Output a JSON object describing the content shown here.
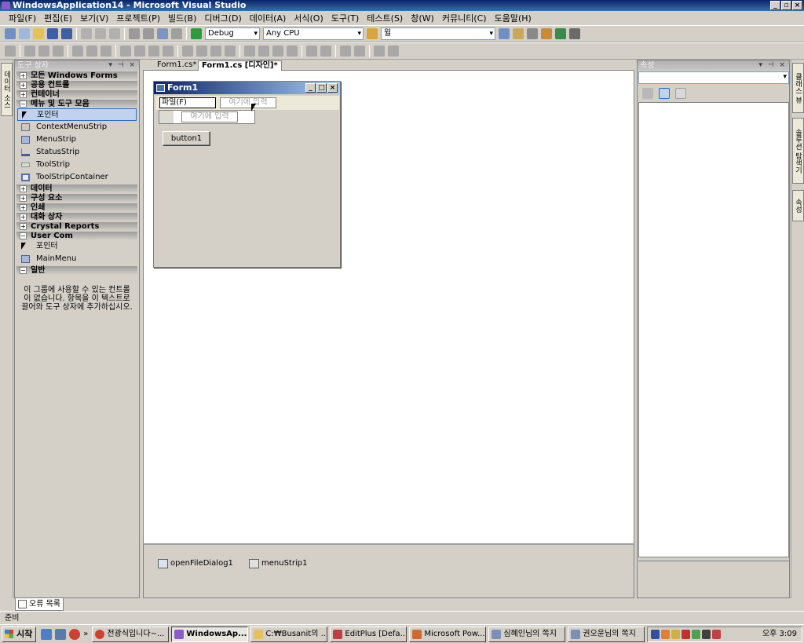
{
  "window": {
    "title": "WindowsApplication14 - Microsoft Visual Studio",
    "min": "_",
    "max": "▫",
    "close": "×"
  },
  "menu": [
    "파일(F)",
    "편집(E)",
    "보기(V)",
    "프로젝트(P)",
    "빌드(B)",
    "디버그(D)",
    "데이터(A)",
    "서식(O)",
    "도구(T)",
    "테스트(S)",
    "창(W)",
    "커뮤니티(C)",
    "도움말(H)"
  ],
  "toolbar": {
    "config": "Debug",
    "platform": "Any CPU",
    "find": "윌"
  },
  "left_strip": {
    "data_sources": "데이터 소스",
    "toolbox": "도구 상자"
  },
  "toolbox": {
    "title": "도구 상자",
    "controls": "▾ ⊣ ×",
    "cat_all": "모든 Windows Forms",
    "cat_common": "공용 컨트롤",
    "cat_containers": "컨테이너",
    "cat_menus": "메뉴 및 도구 모음",
    "menu_items": [
      "포인터",
      "ContextMenuStrip",
      "MenuStrip",
      "StatusStrip",
      "ToolStrip",
      "ToolStripContainer"
    ],
    "cat_data": "데이터",
    "cat_components": "구성 요소",
    "cat_printing": "인쇄",
    "cat_dialogs": "대화 상자",
    "cat_crystal": "Crystal Reports",
    "cat_user": "User Com",
    "user_items": [
      "포인터",
      "MainMenu"
    ],
    "cat_general": "일반",
    "empty_msg": "이 그룹에 사용할 수 있는 컨트롤이 없습니다. 항목을 이 텍스트로 끌어와 도구 상자에 추가하십시오."
  },
  "doc_tabs": {
    "tab1": "Form1.cs*",
    "tab2": "Form1.cs [디자인]*"
  },
  "form1": {
    "title": "Form1",
    "menu_file": "파일(F)",
    "type_here": "여기에 입력",
    "dropdown_type_here": "여기에 입력",
    "button1": "button1"
  },
  "tray": {
    "item1": "openFileDialog1",
    "item2": "menuStrip1"
  },
  "properties": {
    "title": "속성",
    "controls": "▾ ⊣ ×"
  },
  "right_strip": {
    "solution_explorer": "솔루션 탐색기",
    "class_view": "클래스 뷰",
    "properties": "속성"
  },
  "error_tab": "오류 목록",
  "status": "준비",
  "taskbar": {
    "start": "시작",
    "tasks": [
      "전광식입니다~...",
      "WindowsAp...",
      "C:₩Busanit의 ...",
      "EditPlus [Defa...",
      "Microsoft Pow...",
      "심혜인님의 쪽지",
      "권오윤님의 쪽지"
    ],
    "clock": "오후 3:09"
  }
}
